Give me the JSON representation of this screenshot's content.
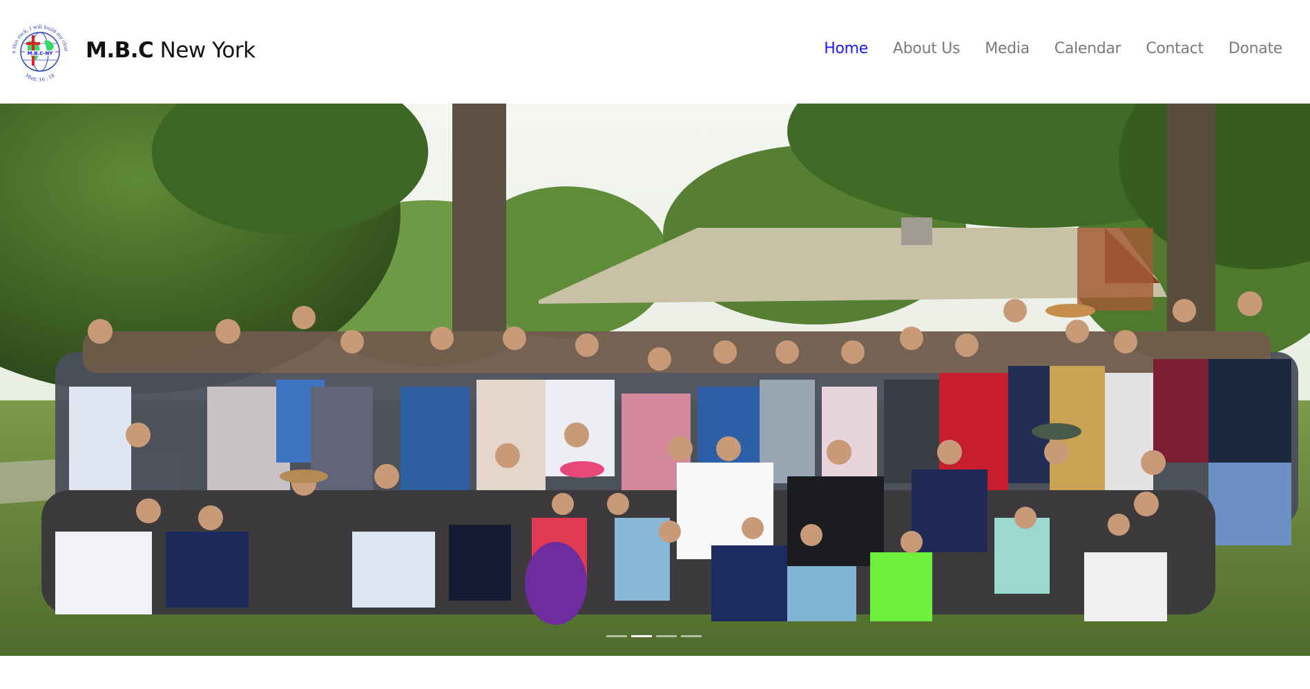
{
  "site": {
    "name_strong": "M.B.C",
    "name_rest": "New York",
    "logo_text_top": "On this rock, I will build my church",
    "logo_text_center": "M.B.C-NY",
    "logo_text_bottom": "Matt. 16 : 18"
  },
  "nav": {
    "items": [
      {
        "label": "Home",
        "active": true
      },
      {
        "label": "About Us",
        "active": false
      },
      {
        "label": "Media",
        "active": false
      },
      {
        "label": "Calendar",
        "active": false
      },
      {
        "label": "Contact",
        "active": false
      },
      {
        "label": "Donate",
        "active": false
      }
    ]
  },
  "hero": {
    "slide_count": 4,
    "active_slide": 2
  },
  "colors": {
    "nav_active": "#1a1aff",
    "nav_default": "#7a7a7a",
    "brand_text": "#111111"
  }
}
